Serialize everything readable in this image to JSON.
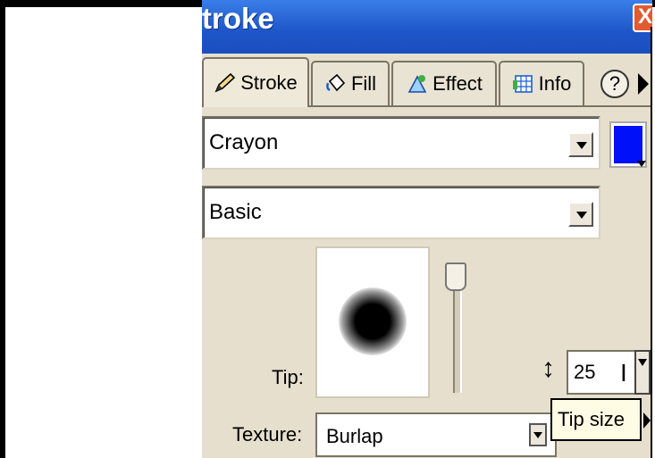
{
  "window": {
    "title": "troke",
    "close_glyph": "X"
  },
  "tabs": [
    {
      "label": "Stroke",
      "icon": "pencil-icon",
      "active": true
    },
    {
      "label": "Fill",
      "icon": "paint-bucket-icon",
      "active": false
    },
    {
      "label": "Effect",
      "icon": "effect-icon",
      "active": false
    },
    {
      "label": "Info",
      "icon": "info-grid-icon",
      "active": false
    }
  ],
  "help_label": "?",
  "stroke": {
    "category": "Crayon",
    "type": "Basic",
    "color": "#0010f8"
  },
  "tip": {
    "label": "Tip:",
    "size_value": "25",
    "size_cursor": "I"
  },
  "texture": {
    "label": "Texture:",
    "value": "Burlap"
  },
  "tooltip": "Tip size",
  "colors": {
    "title_bar": "#1d55c8",
    "panel": "#e6dfcd",
    "close_button": "#e05a32"
  }
}
